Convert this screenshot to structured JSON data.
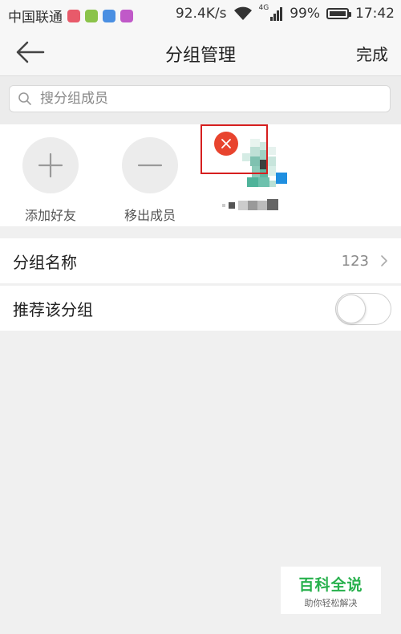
{
  "status_bar": {
    "carrier": "中国联通",
    "app_icon_colors": [
      "#e85a6a",
      "#8bc34a",
      "#4a8fe2",
      "#c059c8"
    ],
    "speed": "92.4K/s",
    "network_type": "4G",
    "battery": "99%",
    "battery_level": 0.99,
    "time": "17:42"
  },
  "header": {
    "title": "分组管理",
    "done_label": "完成"
  },
  "search": {
    "placeholder": "搜分组成员"
  },
  "members": {
    "add_label": "添加好友",
    "remove_label": "移出成员"
  },
  "group_name_row": {
    "label": "分组名称",
    "value": "123"
  },
  "recommend_row": {
    "label": "推荐该分组",
    "toggle_on": false
  },
  "watermark": {
    "title": "百科全说",
    "subtitle": "助你轻松解决"
  },
  "colors": {
    "accent_remove": "#e8442e",
    "highlight_border": "#d61f1f",
    "watermark_green": "#28b14d"
  }
}
